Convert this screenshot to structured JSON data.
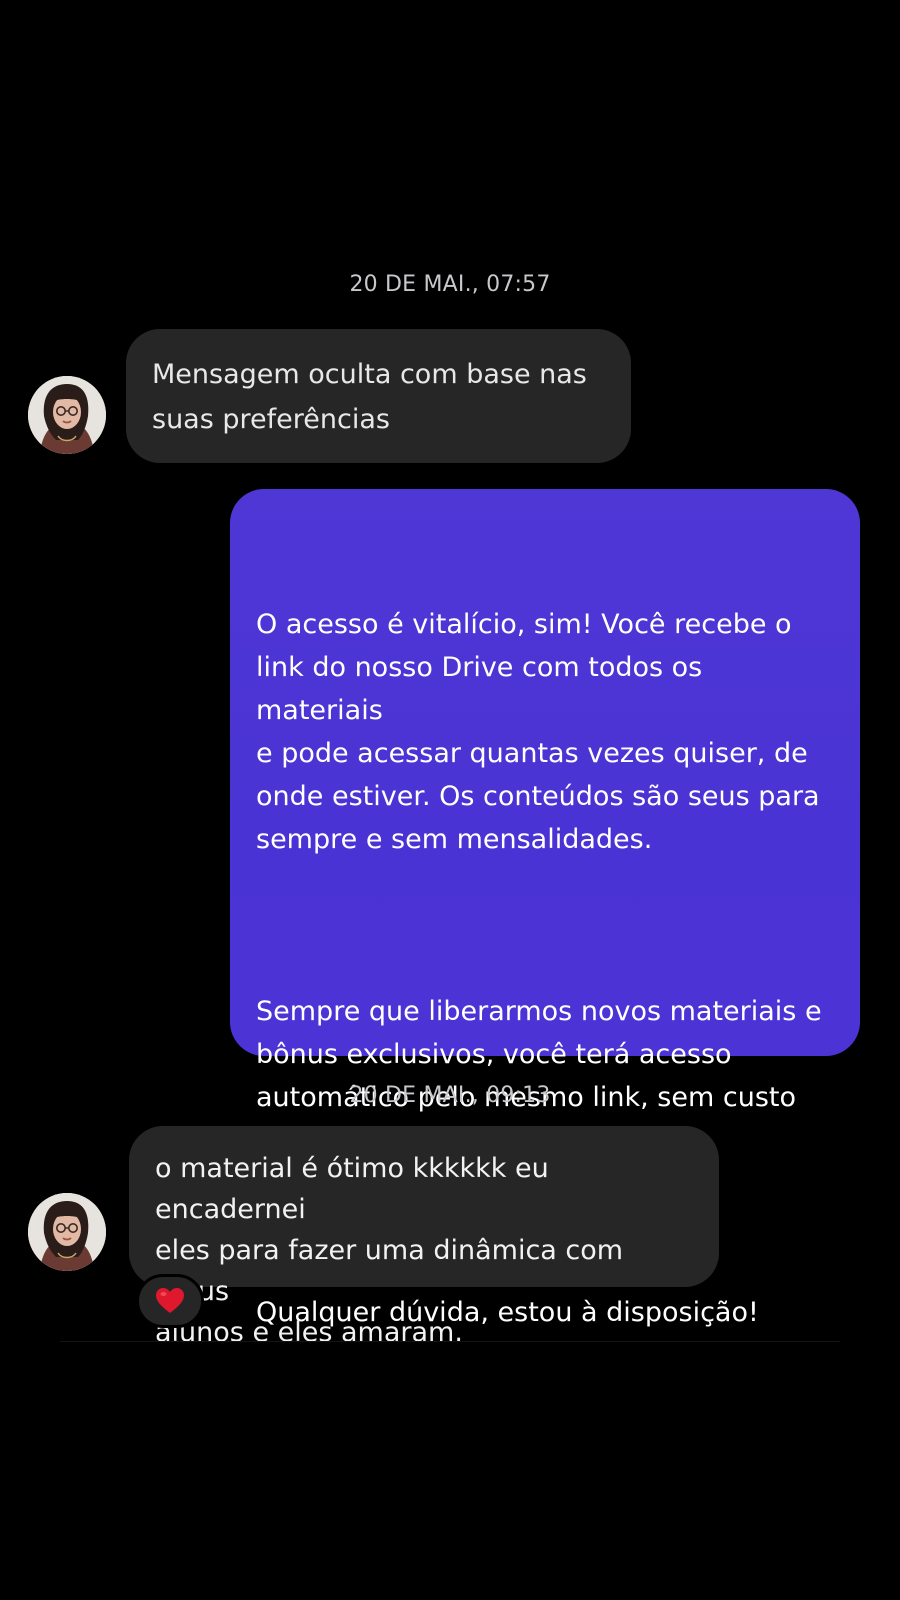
{
  "thread": {
    "timestamp_1": "20 DE MAI., 07:57",
    "hidden_message": "Mensagem oculta com base nas\nsuas preferências",
    "outgoing_message": {
      "paragraphs": [
        "O acesso é vitalício, sim! Você recebe o\nlink do nosso Drive com todos os materiais\ne pode acessar quantas vezes quiser, de\nonde estiver. Os conteúdos são seus para\nsempre e sem mensalidades.",
        "Sempre que liberarmos novos materiais e\nbônus exclusivos, você terá acesso\nautomático pelo mesmo link, sem custo\nadicional.",
        "Qualquer dúvida, estou à disposição!"
      ]
    },
    "timestamp_2": "20 DE MAI., 09:13",
    "incoming_message": "o material é ótimo kkkkkk eu encadernei\neles para fazer uma dinâmica com meus\nalunos e eles amaram.",
    "reaction": {
      "icon": "red-heart-icon",
      "color": "#e0182d"
    }
  },
  "colors": {
    "background": "#000000",
    "incoming_bubble": "#262626",
    "outgoing_bubble": "#4b34d5",
    "timestamp_text": "#c8c8cc"
  }
}
